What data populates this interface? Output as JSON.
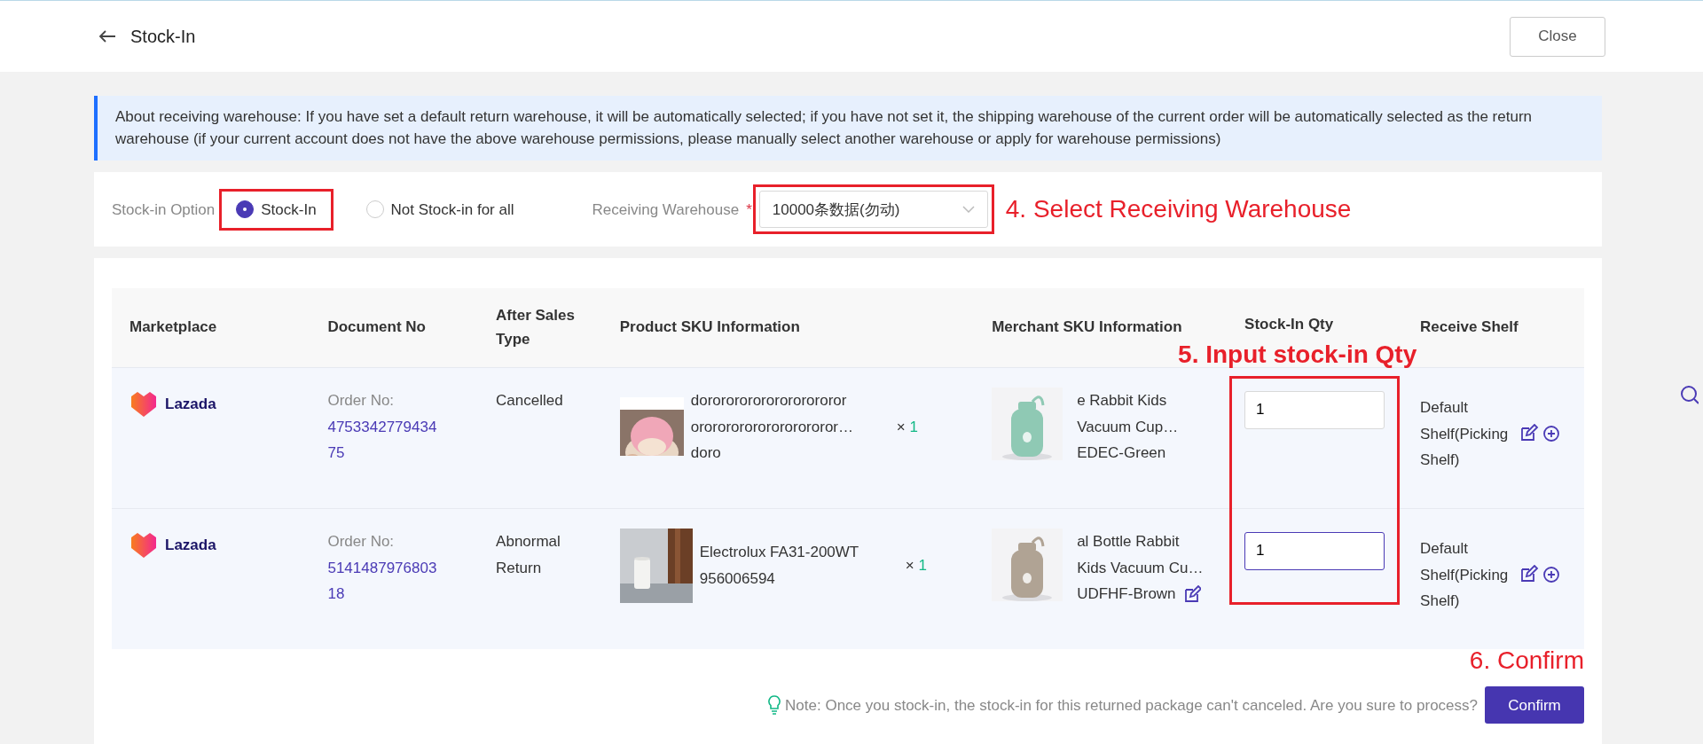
{
  "header": {
    "title": "Stock-In",
    "close": "Close"
  },
  "notice": "About receiving warehouse: If you have set a default return warehouse, it will be automatically selected; if you have not set it, the shipping warehouse of the current order will be automatically selected as the return warehouse (if your current account does not have the above warehouse permissions, please manually select another warehouse or apply for warehouse permissions)",
  "options": {
    "label": "Stock-in Option",
    "choices": [
      {
        "label": "Stock-In",
        "selected": true,
        "highlighted": true
      },
      {
        "label": "Not Stock-in for all",
        "selected": false,
        "highlighted": false
      }
    ],
    "warehouse_label": "Receiving Warehouse",
    "required_mark": "*",
    "warehouse_value": "10000条数据(勿动)",
    "warehouse_highlighted": true,
    "callout": "4. Select Receiving Warehouse"
  },
  "table": {
    "columns": [
      "Marketplace",
      "Document No",
      "After Sales Type",
      "Product SKU Information",
      "Merchant SKU Information",
      "Stock-In Qty",
      "Receive Shelf"
    ],
    "qty_callout": "5. Input stock-in Qty",
    "qty_highlighted": true,
    "rows": [
      {
        "marketplace": "Lazada",
        "doc_label": "Order No:",
        "doc_no": "475334277943475",
        "type": "Cancelled",
        "product_lines": [
          "dororororororororororor",
          "ororororororororororor…"
        ],
        "product_variant": "doro",
        "times": "×",
        "count": "1",
        "merchant_name": "e Rabbit Kids Vacuum Cup…",
        "merchant_sku": "EDEC-Green",
        "sku_editable": false,
        "qty": "1",
        "focused": false,
        "shelf": "Default Shelf(Picking Shelf)"
      },
      {
        "marketplace": "Lazada",
        "doc_label": "Order No:",
        "doc_no": "514148797680318",
        "type": "Abnormal Return",
        "product_lines": [
          "Electrolux FA31-200WT"
        ],
        "product_variant": "956006594",
        "times": "×",
        "count": "1",
        "merchant_name": "al Bottle Rabbit Kids Vacuum Cu…",
        "merchant_sku": "UDFHF-Brown",
        "sku_editable": true,
        "qty": "1",
        "focused": true,
        "shelf": "Default Shelf(Picking Shelf)"
      }
    ]
  },
  "footer": {
    "note": "Note: Once you stock-in, the stock-in for this returned package can't canceled. Are you sure to process?",
    "confirm": "Confirm",
    "callout": "6. Confirm"
  }
}
